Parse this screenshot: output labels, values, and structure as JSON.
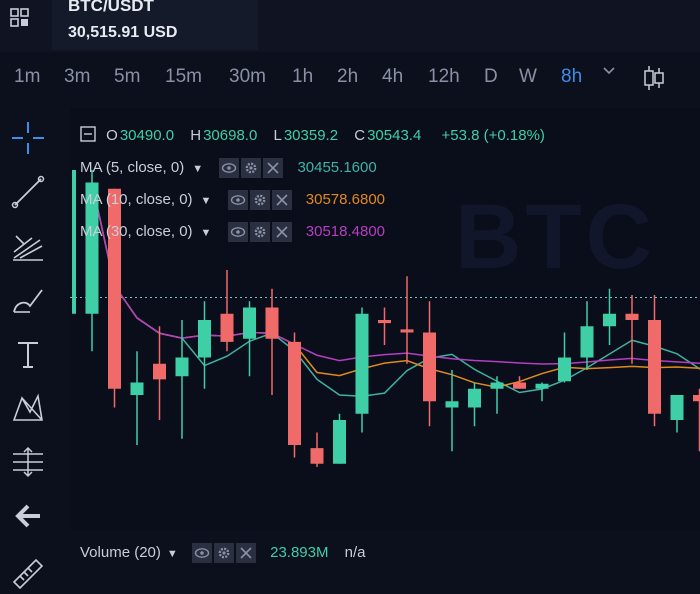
{
  "header": {
    "symbol": "BTC/USDT",
    "price": "30,515.91 USD"
  },
  "intervals": [
    "1m",
    "3m",
    "5m",
    "15m",
    "30m",
    "1h",
    "2h",
    "4h",
    "12h",
    "D",
    "W",
    "8h"
  ],
  "active_interval": "8h",
  "legend": {
    "ohlc": {
      "o_label": "O",
      "o_value": "30490.0",
      "h_label": "H",
      "h_value": "30698.0",
      "l_label": "L",
      "l_value": "30359.2",
      "c_label": "C",
      "c_value": "30543.4",
      "change": "+53.8 (+0.18%)"
    },
    "ma": [
      {
        "label": "MA (5, close, 0)",
        "value": "30455.1600",
        "color": "#3fb3a2"
      },
      {
        "label": "MA (10, close, 0)",
        "value": "30578.6800",
        "color": "#e08a1e"
      },
      {
        "label": "MA (30, close, 0)",
        "value": "30518.4800",
        "color": "#b43fc0"
      }
    ]
  },
  "volume": {
    "label": "Volume (20)",
    "value": "23.893M",
    "na": "n/a"
  },
  "watermark": "BTC",
  "colors": {
    "up": "#3fcfa6",
    "down": "#f06a6a",
    "accent": "#3d8ee8",
    "price_line": "#66c7c7"
  },
  "chart_data": {
    "type": "candlestick",
    "ylim": [
      30240,
      30800
    ],
    "last_price": 30515.91,
    "candles": [
      {
        "o": 30490,
        "h": 30720,
        "l": 30430,
        "c": 30700
      },
      {
        "o": 30690,
        "h": 30690,
        "l": 30340,
        "c": 30370
      },
      {
        "o": 30360,
        "h": 30430,
        "l": 30280,
        "c": 30380
      },
      {
        "o": 30410,
        "h": 30470,
        "l": 30320,
        "c": 30385
      },
      {
        "o": 30390,
        "h": 30480,
        "l": 30290,
        "c": 30420
      },
      {
        "o": 30420,
        "h": 30510,
        "l": 30370,
        "c": 30480
      },
      {
        "o": 30490,
        "h": 30560,
        "l": 30430,
        "c": 30445
      },
      {
        "o": 30450,
        "h": 30510,
        "l": 30390,
        "c": 30500
      },
      {
        "o": 30500,
        "h": 30530,
        "l": 30360,
        "c": 30450
      },
      {
        "o": 30445,
        "h": 30460,
        "l": 30260,
        "c": 30280
      },
      {
        "o": 30275,
        "h": 30300,
        "l": 30245,
        "c": 30250
      },
      {
        "o": 30250,
        "h": 30330,
        "l": 30250,
        "c": 30320
      },
      {
        "o": 30330,
        "h": 30500,
        "l": 30300,
        "c": 30490
      },
      {
        "o": 30480,
        "h": 30500,
        "l": 30440,
        "c": 30475
      },
      {
        "o": 30465,
        "h": 30550,
        "l": 30410,
        "c": 30460
      },
      {
        "o": 30460,
        "h": 30510,
        "l": 30310,
        "c": 30350
      },
      {
        "o": 30340,
        "h": 30400,
        "l": 30270,
        "c": 30350
      },
      {
        "o": 30340,
        "h": 30380,
        "l": 30310,
        "c": 30370
      },
      {
        "o": 30370,
        "h": 30390,
        "l": 30330,
        "c": 30380
      },
      {
        "o": 30380,
        "h": 30390,
        "l": 30370,
        "c": 30370
      },
      {
        "o": 30370,
        "h": 30380,
        "l": 30350,
        "c": 30378
      },
      {
        "o": 30382,
        "h": 30460,
        "l": 30380,
        "c": 30420
      },
      {
        "o": 30420,
        "h": 30510,
        "l": 30400,
        "c": 30470
      },
      {
        "o": 30470,
        "h": 30530,
        "l": 30440,
        "c": 30490
      },
      {
        "o": 30490,
        "h": 30520,
        "l": 30410,
        "c": 30480
      },
      {
        "o": 30480,
        "h": 30520,
        "l": 30310,
        "c": 30330
      },
      {
        "o": 30320,
        "h": 30360,
        "l": 30300,
        "c": 30360
      },
      {
        "o": 30360,
        "h": 30370,
        "l": 30270,
        "c": 30350
      },
      {
        "o": 30350,
        "h": 30410,
        "l": 30330,
        "c": 30400
      },
      {
        "o": 30400,
        "h": 30420,
        "l": 30360,
        "c": 30395
      }
    ]
  }
}
